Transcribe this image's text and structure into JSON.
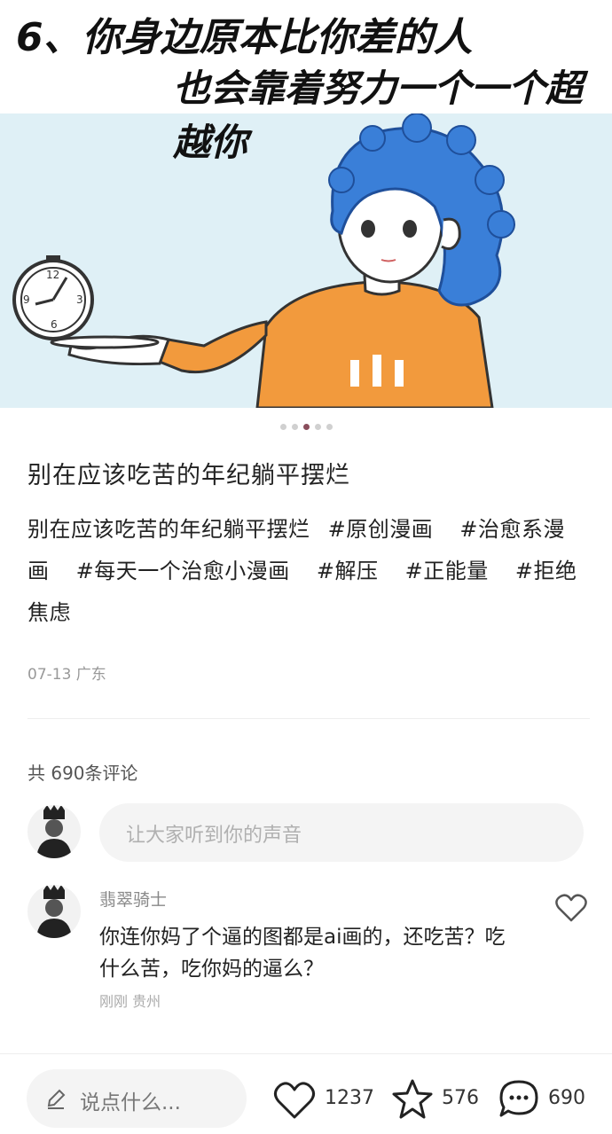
{
  "hero": {
    "line1": "6、你身边原本比你差的人",
    "line2": "也会靠着努力一个一个超越你",
    "colors": {
      "sky": "#dff0f6",
      "hair": "#3a7fd8",
      "sweater": "#f29a3d"
    }
  },
  "carousel": {
    "total": 5,
    "active_index": 3
  },
  "post": {
    "title": "别在应该吃苦的年纪躺平摆烂",
    "desc": "别在应该吃苦的年纪躺平摆烂",
    "tags": [
      "#原创漫画",
      "#治愈系漫画",
      "#每天一个治愈小漫画",
      "#解压",
      "#正能量",
      "#拒绝焦虑"
    ],
    "meta": "07-13 广东"
  },
  "comments": {
    "count_label": "共 690条评论",
    "input_placeholder": "让大家听到你的声音",
    "items": [
      {
        "user": "翡翠骑士",
        "text": "你连你妈了个逼的图都是ai画的，还吃苦？吃什么苦，吃你妈的逼么？",
        "meta": "刚刚 贵州"
      }
    ]
  },
  "bottom": {
    "say_placeholder": "说点什么...",
    "likes": "1237",
    "favorites": "576",
    "comments": "690"
  }
}
